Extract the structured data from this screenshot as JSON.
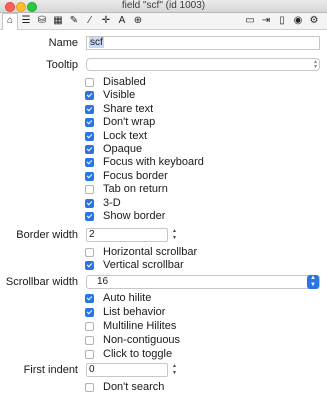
{
  "window": {
    "title": "field \"scf\" (id 1003)"
  },
  "toolbar": {
    "left_icons": [
      "home-icon",
      "list-icon",
      "database-icon",
      "grid-icon",
      "pencil-icon",
      "wand-icon",
      "move-icon",
      "text-size-icon",
      "target-icon"
    ],
    "right_icons": [
      "window-icon",
      "enter-icon",
      "document-icon",
      "record-icon",
      "gear-icon"
    ]
  },
  "props": {
    "name_label": "Name",
    "name_value": "scf",
    "tooltip_label": "Tooltip",
    "tooltip_value": "",
    "border_width_label": "Border width",
    "border_width_value": "2",
    "scrollbar_width_label": "Scrollbar width",
    "scrollbar_width_value": "16",
    "first_indent_label": "First indent",
    "first_indent_value": "0"
  },
  "group1": [
    {
      "label": "Disabled",
      "checked": false
    },
    {
      "label": "Visible",
      "checked": true
    },
    {
      "label": "Share text",
      "checked": true
    },
    {
      "label": "Don't wrap",
      "checked": true
    },
    {
      "label": "Lock text",
      "checked": true
    },
    {
      "label": "Opaque",
      "checked": true
    },
    {
      "label": "Focus with keyboard",
      "checked": true
    },
    {
      "label": "Focus border",
      "checked": true
    },
    {
      "label": "Tab on return",
      "checked": false
    },
    {
      "label": "3-D",
      "checked": true
    },
    {
      "label": "Show border",
      "checked": true
    }
  ],
  "group2": [
    {
      "label": "Horizontal scrollbar",
      "checked": false
    },
    {
      "label": "Vertical scrollbar",
      "checked": true
    }
  ],
  "group3": [
    {
      "label": "Auto hilite",
      "checked": true
    },
    {
      "label": "List behavior",
      "checked": true
    },
    {
      "label": "Multiline Hilites",
      "checked": false
    },
    {
      "label": "Non-contiguous",
      "checked": false
    },
    {
      "label": "Click to toggle",
      "checked": false
    }
  ],
  "group4": [
    {
      "label": "Don't search",
      "checked": false
    }
  ],
  "colors": {
    "accent": "#2b74e6"
  }
}
